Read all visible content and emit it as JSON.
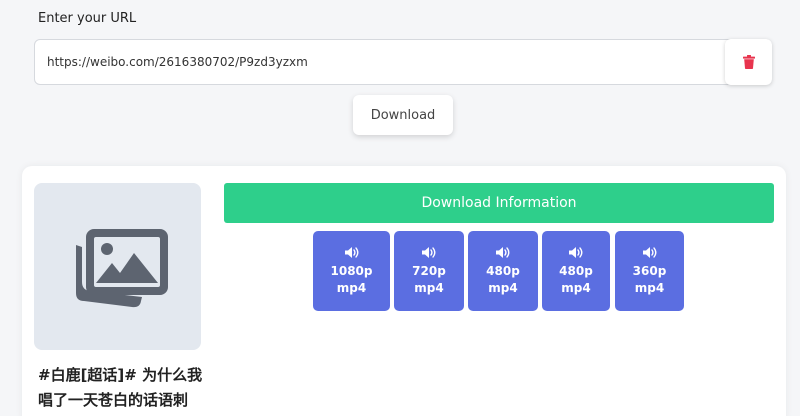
{
  "form": {
    "label": "Enter your URL",
    "url_value": "https://weibo.com/2616380702/P9zd3yzxm",
    "download_label": "Download"
  },
  "result": {
    "title": "#白鹿[超话]# 为什么我唱了一天苍白的话语刺",
    "info_label": "Download Information",
    "formats": [
      {
        "quality": "1080p",
        "ext": "mp4"
      },
      {
        "quality": "720p",
        "ext": "mp4"
      },
      {
        "quality": "480p",
        "ext": "mp4"
      },
      {
        "quality": "480p",
        "ext": "mp4"
      },
      {
        "quality": "360p",
        "ext": "mp4"
      }
    ]
  },
  "icons": {
    "clear": "trash-icon",
    "thumbnail": "images-icon",
    "format": "volume-icon"
  },
  "colors": {
    "accent_green": "#2ecf8b",
    "format_blue": "#5b6ee1",
    "danger_red": "#e8344e"
  }
}
